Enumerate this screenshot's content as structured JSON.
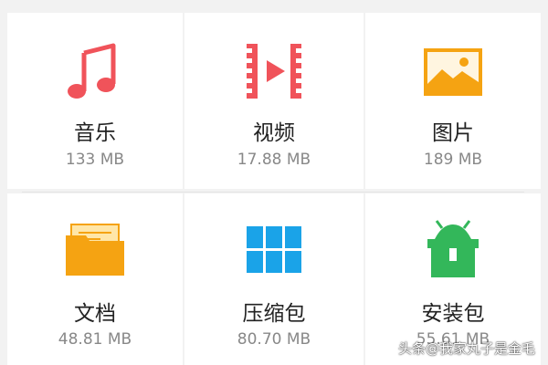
{
  "categories": [
    {
      "label": "音乐",
      "size": "133 MB",
      "icon": "music-icon",
      "color": "#f0535a"
    },
    {
      "label": "视频",
      "size": "17.88 MB",
      "icon": "video-icon",
      "color": "#f0535a"
    },
    {
      "label": "图片",
      "size": "189 MB",
      "icon": "image-icon",
      "color": "#f5a312"
    },
    {
      "label": "文档",
      "size": "48.81 MB",
      "icon": "folder-icon",
      "color": "#f5a312"
    },
    {
      "label": "压缩包",
      "size": "80.70 MB",
      "icon": "archive-icon",
      "color": "#1aa3e8"
    },
    {
      "label": "安装包",
      "size": "55.61 MB",
      "icon": "android-package-icon",
      "color": "#33b75a"
    }
  ],
  "watermark": "头条@我家丸子是金毛"
}
